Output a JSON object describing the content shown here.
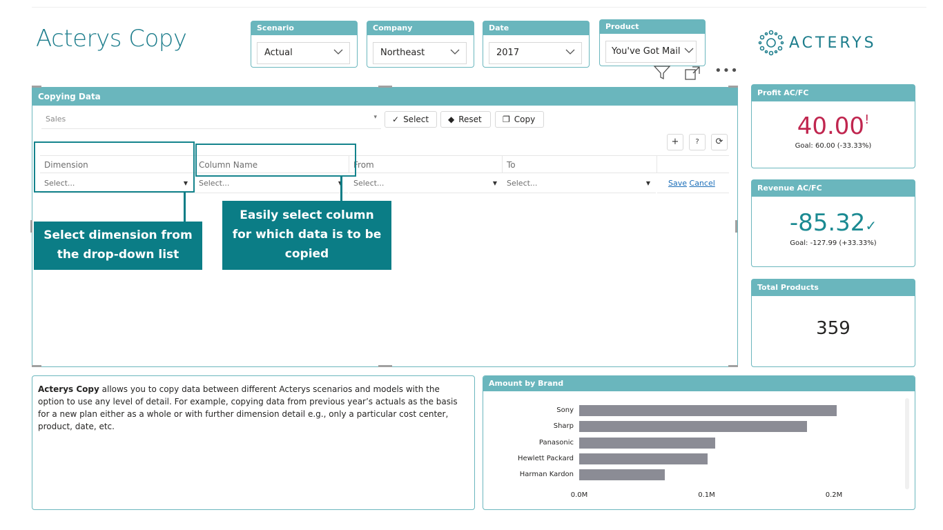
{
  "app": {
    "title": "Acterys Copy",
    "logo_text": "ACTERYS"
  },
  "slicers": [
    {
      "label": "Scenario",
      "value": "Actual"
    },
    {
      "label": "Company",
      "value": "Northeast"
    },
    {
      "label": "Date",
      "value": "2017"
    },
    {
      "label": "Product",
      "value": "You've Got Mail"
    }
  ],
  "toolbar": {
    "filter_icon": "filter-icon",
    "focus_icon": "focus-mode-icon",
    "more_icon": "more-options-icon"
  },
  "copy_panel": {
    "title": "Copying Data",
    "source_select": "Sales",
    "buttons": {
      "select": "Select",
      "reset": "Reset",
      "copy": "Copy"
    },
    "small_buttons": {
      "add": "+",
      "help": "?",
      "refresh": "⟳"
    },
    "columns": [
      "Dimension",
      "Column Name",
      "From",
      "To"
    ],
    "row": {
      "dimension": "Select...",
      "column_name": "Select...",
      "from": "Select...",
      "to": "Select...",
      "save": "Save",
      "cancel": "Cancel"
    }
  },
  "callouts": {
    "dimension": "Select dimension from the drop-down list",
    "column": "Easily select column for which data is to be copied"
  },
  "kpis": {
    "profit": {
      "title": "Profit AC/FC",
      "value": "40.00",
      "status": "!",
      "goal": "Goal: 60.00 (-33.33%)",
      "color": "#c0264f"
    },
    "revenue": {
      "title": "Revenue AC/FC",
      "value": "-85.32",
      "status": "✓",
      "goal": "Goal: -127.99 (+33.33%)",
      "color": "#1b8a92"
    },
    "products": {
      "title": "Total Products",
      "value": "359"
    }
  },
  "description": {
    "bold": "Acterys Copy",
    "text": " allows you to copy data between different Acterys scenarios and models with the option to use any level of detail. For example, copying data from previous year’s actuals as the basis for a new plan either as a whole or with further dimension detail e.g., only a particular cost center, product, date, etc."
  },
  "chart_data": {
    "type": "bar",
    "orientation": "horizontal",
    "title": "Amount by Brand",
    "categories": [
      "Sony",
      "Sharp",
      "Panasonic",
      "Hewlett Packard",
      "Harman Kardon"
    ],
    "values": [
      0.202,
      0.179,
      0.107,
      0.101,
      0.067
    ],
    "unit": "M",
    "xlim": [
      0,
      0.2
    ],
    "x_ticks": [
      "0.0M",
      "0.1M",
      "0.2M"
    ],
    "bar_color": "#8b8c95"
  }
}
